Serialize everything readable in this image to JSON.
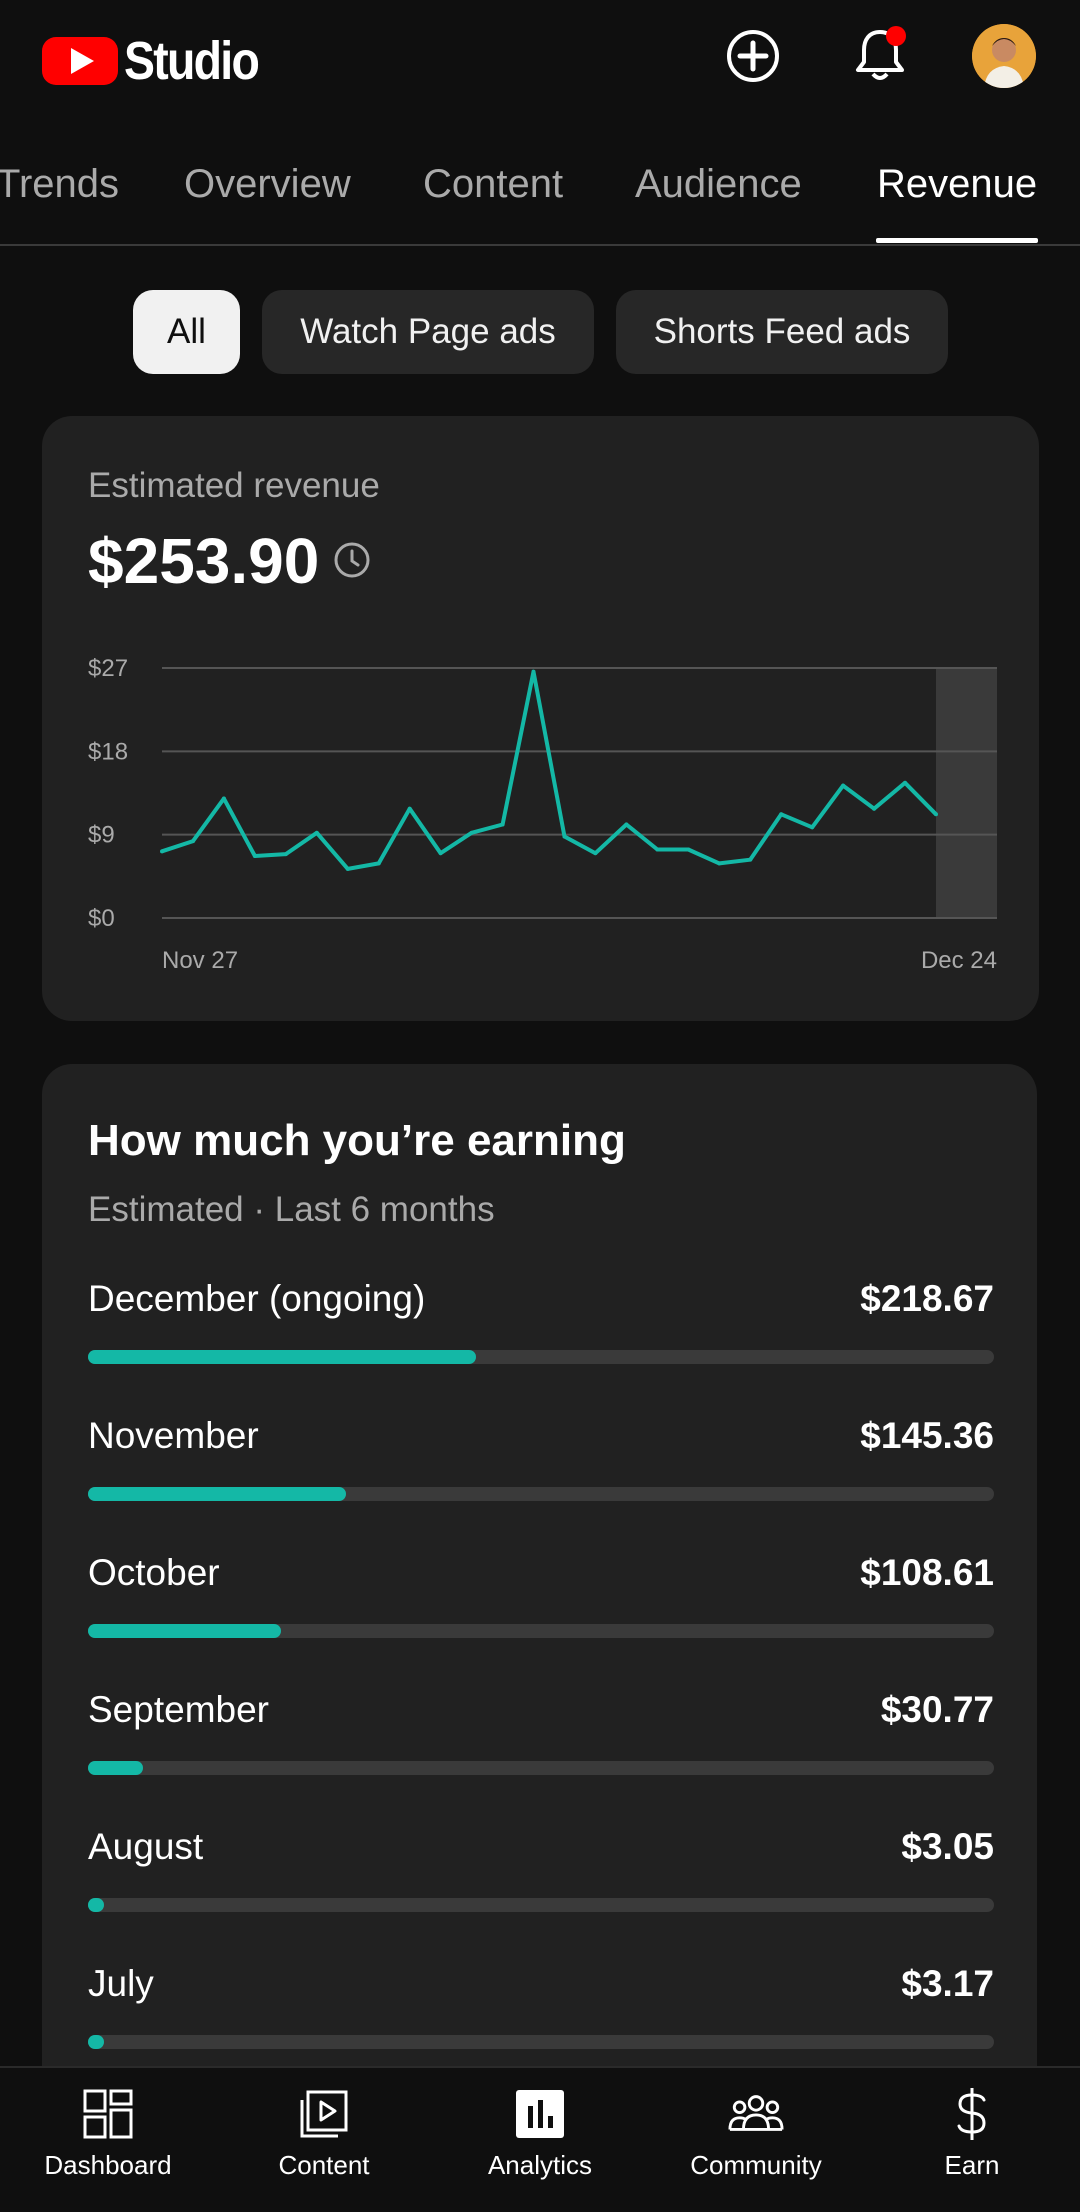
{
  "header": {
    "logo_text": "Studio",
    "icons": [
      "youtube-logo-icon",
      "create-plus-icon",
      "notifications-bell-icon",
      "avatar"
    ]
  },
  "tabs": [
    {
      "label": "Trends"
    },
    {
      "label": "Overview"
    },
    {
      "label": "Content"
    },
    {
      "label": "Audience"
    },
    {
      "label": "Revenue",
      "active": true
    }
  ],
  "filters": [
    {
      "label": "All",
      "active": true
    },
    {
      "label": "Watch Page ads"
    },
    {
      "label": "Shorts Feed ads"
    }
  ],
  "revenue_card": {
    "title": "Estimated revenue",
    "value": "$253.90",
    "chart_data": {
      "type": "line",
      "y_ticks": [
        "$27",
        "$18",
        "$9",
        "$0"
      ],
      "ylim": [
        0,
        27
      ],
      "x_start_label": "Nov 27",
      "x_end_label": "Dec 24",
      "values": [
        7.2,
        8.3,
        12.9,
        6.7,
        6.9,
        9.2,
        5.3,
        5.9,
        11.8,
        7.0,
        9.2,
        10.1,
        26.6,
        8.8,
        7.0,
        10.1,
        7.4,
        7.4,
        5.9,
        6.3,
        11.2,
        9.8,
        14.3,
        11.8,
        14.6,
        11.2
      ],
      "series_color": "#14b8a6",
      "highlight_last_period": true
    }
  },
  "earnings_card": {
    "title": "How much you’re earning",
    "subtitle": "Estimated · Last 6 months",
    "rows": [
      {
        "label": "December (ongoing)",
        "value": "$218.67",
        "amount": 218.67
      },
      {
        "label": "November",
        "value": "$145.36",
        "amount": 145.36
      },
      {
        "label": "October",
        "value": "$108.61",
        "amount": 108.61
      },
      {
        "label": "September",
        "value": "$30.77",
        "amount": 30.77
      },
      {
        "label": "August",
        "value": "$3.05",
        "amount": 3.05
      },
      {
        "label": "July",
        "value": "$3.17",
        "amount": 3.17
      }
    ],
    "bar_max": 510,
    "bar_color": "#14b8a6"
  },
  "bottom_nav": [
    {
      "label": "Dashboard",
      "icon": "dashboard-icon"
    },
    {
      "label": "Content",
      "icon": "content-icon"
    },
    {
      "label": "Analytics",
      "icon": "analytics-icon",
      "active": true
    },
    {
      "label": "Community",
      "icon": "community-icon"
    },
    {
      "label": "Earn",
      "icon": "earn-dollar-icon"
    }
  ]
}
